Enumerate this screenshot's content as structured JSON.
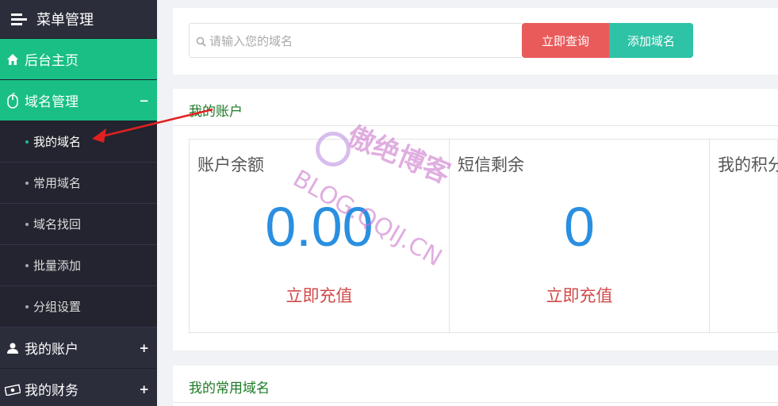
{
  "sidebar": {
    "header": "菜单管理",
    "home": "后台主页",
    "domain_manage": "域名管理",
    "domain_manage_toggle": "−",
    "sub_items": [
      {
        "label": "我的域名"
      },
      {
        "label": "常用域名"
      },
      {
        "label": "域名找回"
      },
      {
        "label": "批量添加"
      },
      {
        "label": "分组设置"
      }
    ],
    "my_account": "我的账户",
    "my_finance": "我的财务",
    "expand_symbol": "+"
  },
  "search": {
    "placeholder": "请输入您的域名",
    "query_button": "立即查询",
    "add_button": "添加域名"
  },
  "account": {
    "title": "我的账户",
    "cards": [
      {
        "label": "账户余额",
        "value": "0.00",
        "action": "立即充值"
      },
      {
        "label": "短信剩余",
        "value": "0",
        "action": "立即充值"
      },
      {
        "label": "我的积分"
      }
    ]
  },
  "domains": {
    "title": "我的常用域名"
  },
  "watermark": {
    "brand": "傲绝博客",
    "url": "BLOG.QQIJ.CN"
  },
  "colors": {
    "sidebar_bg": "#2b2d3b",
    "accent_green": "#19bf85",
    "query_red": "#e95b5b",
    "add_teal": "#2ec2a6",
    "value_blue": "#2a8fe0",
    "action_red": "#d24a4a",
    "title_green": "#1d7a25"
  }
}
